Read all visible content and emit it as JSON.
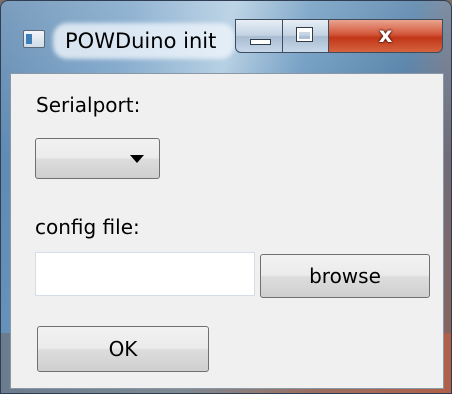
{
  "window": {
    "title": "POWDuino init",
    "close_glyph": "x",
    "icons": {
      "app": "app-window-icon",
      "minimize": "minimize-icon",
      "maximize": "maximize-icon",
      "close": "close-icon"
    }
  },
  "form": {
    "serialport_label": "Serialport:",
    "serialport_selected": "",
    "config_label": "config file:",
    "config_value": "",
    "browse_label": "browse",
    "ok_label": "OK"
  },
  "colors": {
    "close_button": "#c8401e",
    "client_background": "#f0f0f0"
  }
}
